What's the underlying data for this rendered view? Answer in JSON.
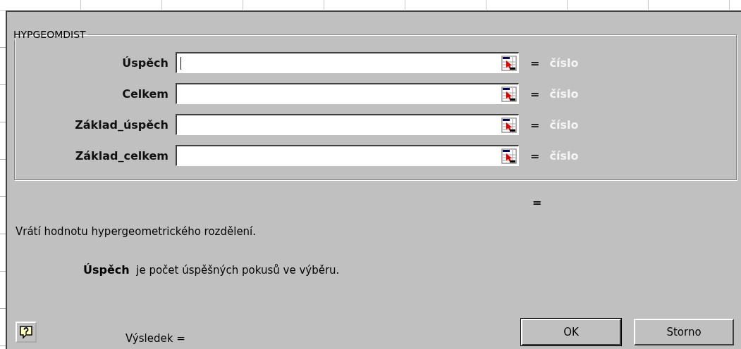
{
  "function_group": {
    "title": "HYPGEOMDIST",
    "arguments": [
      {
        "label": "Úspěch",
        "focused": true,
        "equals": "=",
        "hint": "číslo"
      },
      {
        "label": "Celkem",
        "focused": false,
        "equals": "=",
        "hint": "číslo"
      },
      {
        "label": "Základ_úspěch",
        "focused": false,
        "equals": "=",
        "hint": "číslo"
      },
      {
        "label": "Základ_celkem",
        "focused": false,
        "equals": "=",
        "hint": "číslo"
      }
    ]
  },
  "formula_result": "=",
  "description": "Vrátí hodnotu hypergeometrického rozdělení.",
  "argument_help": "**Úspěch**  je počet úspěšných pokusů ve výběru.",
  "result_label": "Výsledek =",
  "buttons": [
    {
      "label": "OK",
      "default": true
    },
    {
      "label": "Storno",
      "default": false
    }
  ]
}
